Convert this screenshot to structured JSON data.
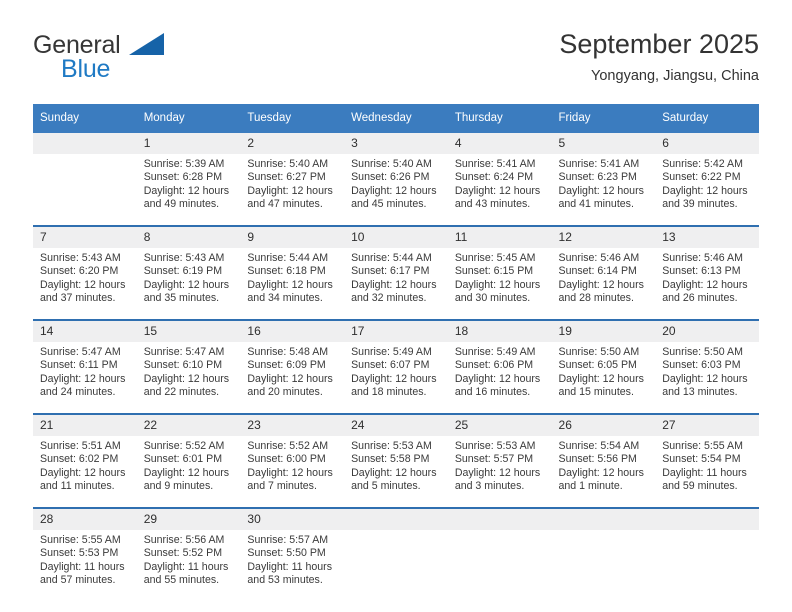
{
  "brand": {
    "name_part1": "General",
    "name_part2": "Blue",
    "triangle_icon": "brand-triangle-icon"
  },
  "header": {
    "title": "September 2025",
    "subtitle": "Yongyang, Jiangsu, China"
  },
  "calendar": {
    "weekday_headers": [
      "Sunday",
      "Monday",
      "Tuesday",
      "Wednesday",
      "Thursday",
      "Friday",
      "Saturday"
    ],
    "colors": {
      "header_background": "#3b7cbf",
      "daynum_background": "#efeff0",
      "row_divider": "#2f6fb0",
      "brand_blue": "#1f7ac4",
      "brand_triangle": "#1663a8"
    },
    "weeks": [
      [
        {
          "day": "",
          "lines": []
        },
        {
          "day": "1",
          "lines": [
            "Sunrise: 5:39 AM",
            "Sunset: 6:28 PM",
            "Daylight: 12 hours",
            "and 49 minutes."
          ]
        },
        {
          "day": "2",
          "lines": [
            "Sunrise: 5:40 AM",
            "Sunset: 6:27 PM",
            "Daylight: 12 hours",
            "and 47 minutes."
          ]
        },
        {
          "day": "3",
          "lines": [
            "Sunrise: 5:40 AM",
            "Sunset: 6:26 PM",
            "Daylight: 12 hours",
            "and 45 minutes."
          ]
        },
        {
          "day": "4",
          "lines": [
            "Sunrise: 5:41 AM",
            "Sunset: 6:24 PM",
            "Daylight: 12 hours",
            "and 43 minutes."
          ]
        },
        {
          "day": "5",
          "lines": [
            "Sunrise: 5:41 AM",
            "Sunset: 6:23 PM",
            "Daylight: 12 hours",
            "and 41 minutes."
          ]
        },
        {
          "day": "6",
          "lines": [
            "Sunrise: 5:42 AM",
            "Sunset: 6:22 PM",
            "Daylight: 12 hours",
            "and 39 minutes."
          ]
        }
      ],
      [
        {
          "day": "7",
          "lines": [
            "Sunrise: 5:43 AM",
            "Sunset: 6:20 PM",
            "Daylight: 12 hours",
            "and 37 minutes."
          ]
        },
        {
          "day": "8",
          "lines": [
            "Sunrise: 5:43 AM",
            "Sunset: 6:19 PM",
            "Daylight: 12 hours",
            "and 35 minutes."
          ]
        },
        {
          "day": "9",
          "lines": [
            "Sunrise: 5:44 AM",
            "Sunset: 6:18 PM",
            "Daylight: 12 hours",
            "and 34 minutes."
          ]
        },
        {
          "day": "10",
          "lines": [
            "Sunrise: 5:44 AM",
            "Sunset: 6:17 PM",
            "Daylight: 12 hours",
            "and 32 minutes."
          ]
        },
        {
          "day": "11",
          "lines": [
            "Sunrise: 5:45 AM",
            "Sunset: 6:15 PM",
            "Daylight: 12 hours",
            "and 30 minutes."
          ]
        },
        {
          "day": "12",
          "lines": [
            "Sunrise: 5:46 AM",
            "Sunset: 6:14 PM",
            "Daylight: 12 hours",
            "and 28 minutes."
          ]
        },
        {
          "day": "13",
          "lines": [
            "Sunrise: 5:46 AM",
            "Sunset: 6:13 PM",
            "Daylight: 12 hours",
            "and 26 minutes."
          ]
        }
      ],
      [
        {
          "day": "14",
          "lines": [
            "Sunrise: 5:47 AM",
            "Sunset: 6:11 PM",
            "Daylight: 12 hours",
            "and 24 minutes."
          ]
        },
        {
          "day": "15",
          "lines": [
            "Sunrise: 5:47 AM",
            "Sunset: 6:10 PM",
            "Daylight: 12 hours",
            "and 22 minutes."
          ]
        },
        {
          "day": "16",
          "lines": [
            "Sunrise: 5:48 AM",
            "Sunset: 6:09 PM",
            "Daylight: 12 hours",
            "and 20 minutes."
          ]
        },
        {
          "day": "17",
          "lines": [
            "Sunrise: 5:49 AM",
            "Sunset: 6:07 PM",
            "Daylight: 12 hours",
            "and 18 minutes."
          ]
        },
        {
          "day": "18",
          "lines": [
            "Sunrise: 5:49 AM",
            "Sunset: 6:06 PM",
            "Daylight: 12 hours",
            "and 16 minutes."
          ]
        },
        {
          "day": "19",
          "lines": [
            "Sunrise: 5:50 AM",
            "Sunset: 6:05 PM",
            "Daylight: 12 hours",
            "and 15 minutes."
          ]
        },
        {
          "day": "20",
          "lines": [
            "Sunrise: 5:50 AM",
            "Sunset: 6:03 PM",
            "Daylight: 12 hours",
            "and 13 minutes."
          ]
        }
      ],
      [
        {
          "day": "21",
          "lines": [
            "Sunrise: 5:51 AM",
            "Sunset: 6:02 PM",
            "Daylight: 12 hours",
            "and 11 minutes."
          ]
        },
        {
          "day": "22",
          "lines": [
            "Sunrise: 5:52 AM",
            "Sunset: 6:01 PM",
            "Daylight: 12 hours",
            "and 9 minutes."
          ]
        },
        {
          "day": "23",
          "lines": [
            "Sunrise: 5:52 AM",
            "Sunset: 6:00 PM",
            "Daylight: 12 hours",
            "and 7 minutes."
          ]
        },
        {
          "day": "24",
          "lines": [
            "Sunrise: 5:53 AM",
            "Sunset: 5:58 PM",
            "Daylight: 12 hours",
            "and 5 minutes."
          ]
        },
        {
          "day": "25",
          "lines": [
            "Sunrise: 5:53 AM",
            "Sunset: 5:57 PM",
            "Daylight: 12 hours",
            "and 3 minutes."
          ]
        },
        {
          "day": "26",
          "lines": [
            "Sunrise: 5:54 AM",
            "Sunset: 5:56 PM",
            "Daylight: 12 hours",
            "and 1 minute."
          ]
        },
        {
          "day": "27",
          "lines": [
            "Sunrise: 5:55 AM",
            "Sunset: 5:54 PM",
            "Daylight: 11 hours",
            "and 59 minutes."
          ]
        }
      ],
      [
        {
          "day": "28",
          "lines": [
            "Sunrise: 5:55 AM",
            "Sunset: 5:53 PM",
            "Daylight: 11 hours",
            "and 57 minutes."
          ]
        },
        {
          "day": "29",
          "lines": [
            "Sunrise: 5:56 AM",
            "Sunset: 5:52 PM",
            "Daylight: 11 hours",
            "and 55 minutes."
          ]
        },
        {
          "day": "30",
          "lines": [
            "Sunrise: 5:57 AM",
            "Sunset: 5:50 PM",
            "Daylight: 11 hours",
            "and 53 minutes."
          ]
        },
        {
          "day": "",
          "lines": []
        },
        {
          "day": "",
          "lines": []
        },
        {
          "day": "",
          "lines": []
        },
        {
          "day": "",
          "lines": []
        }
      ]
    ]
  }
}
